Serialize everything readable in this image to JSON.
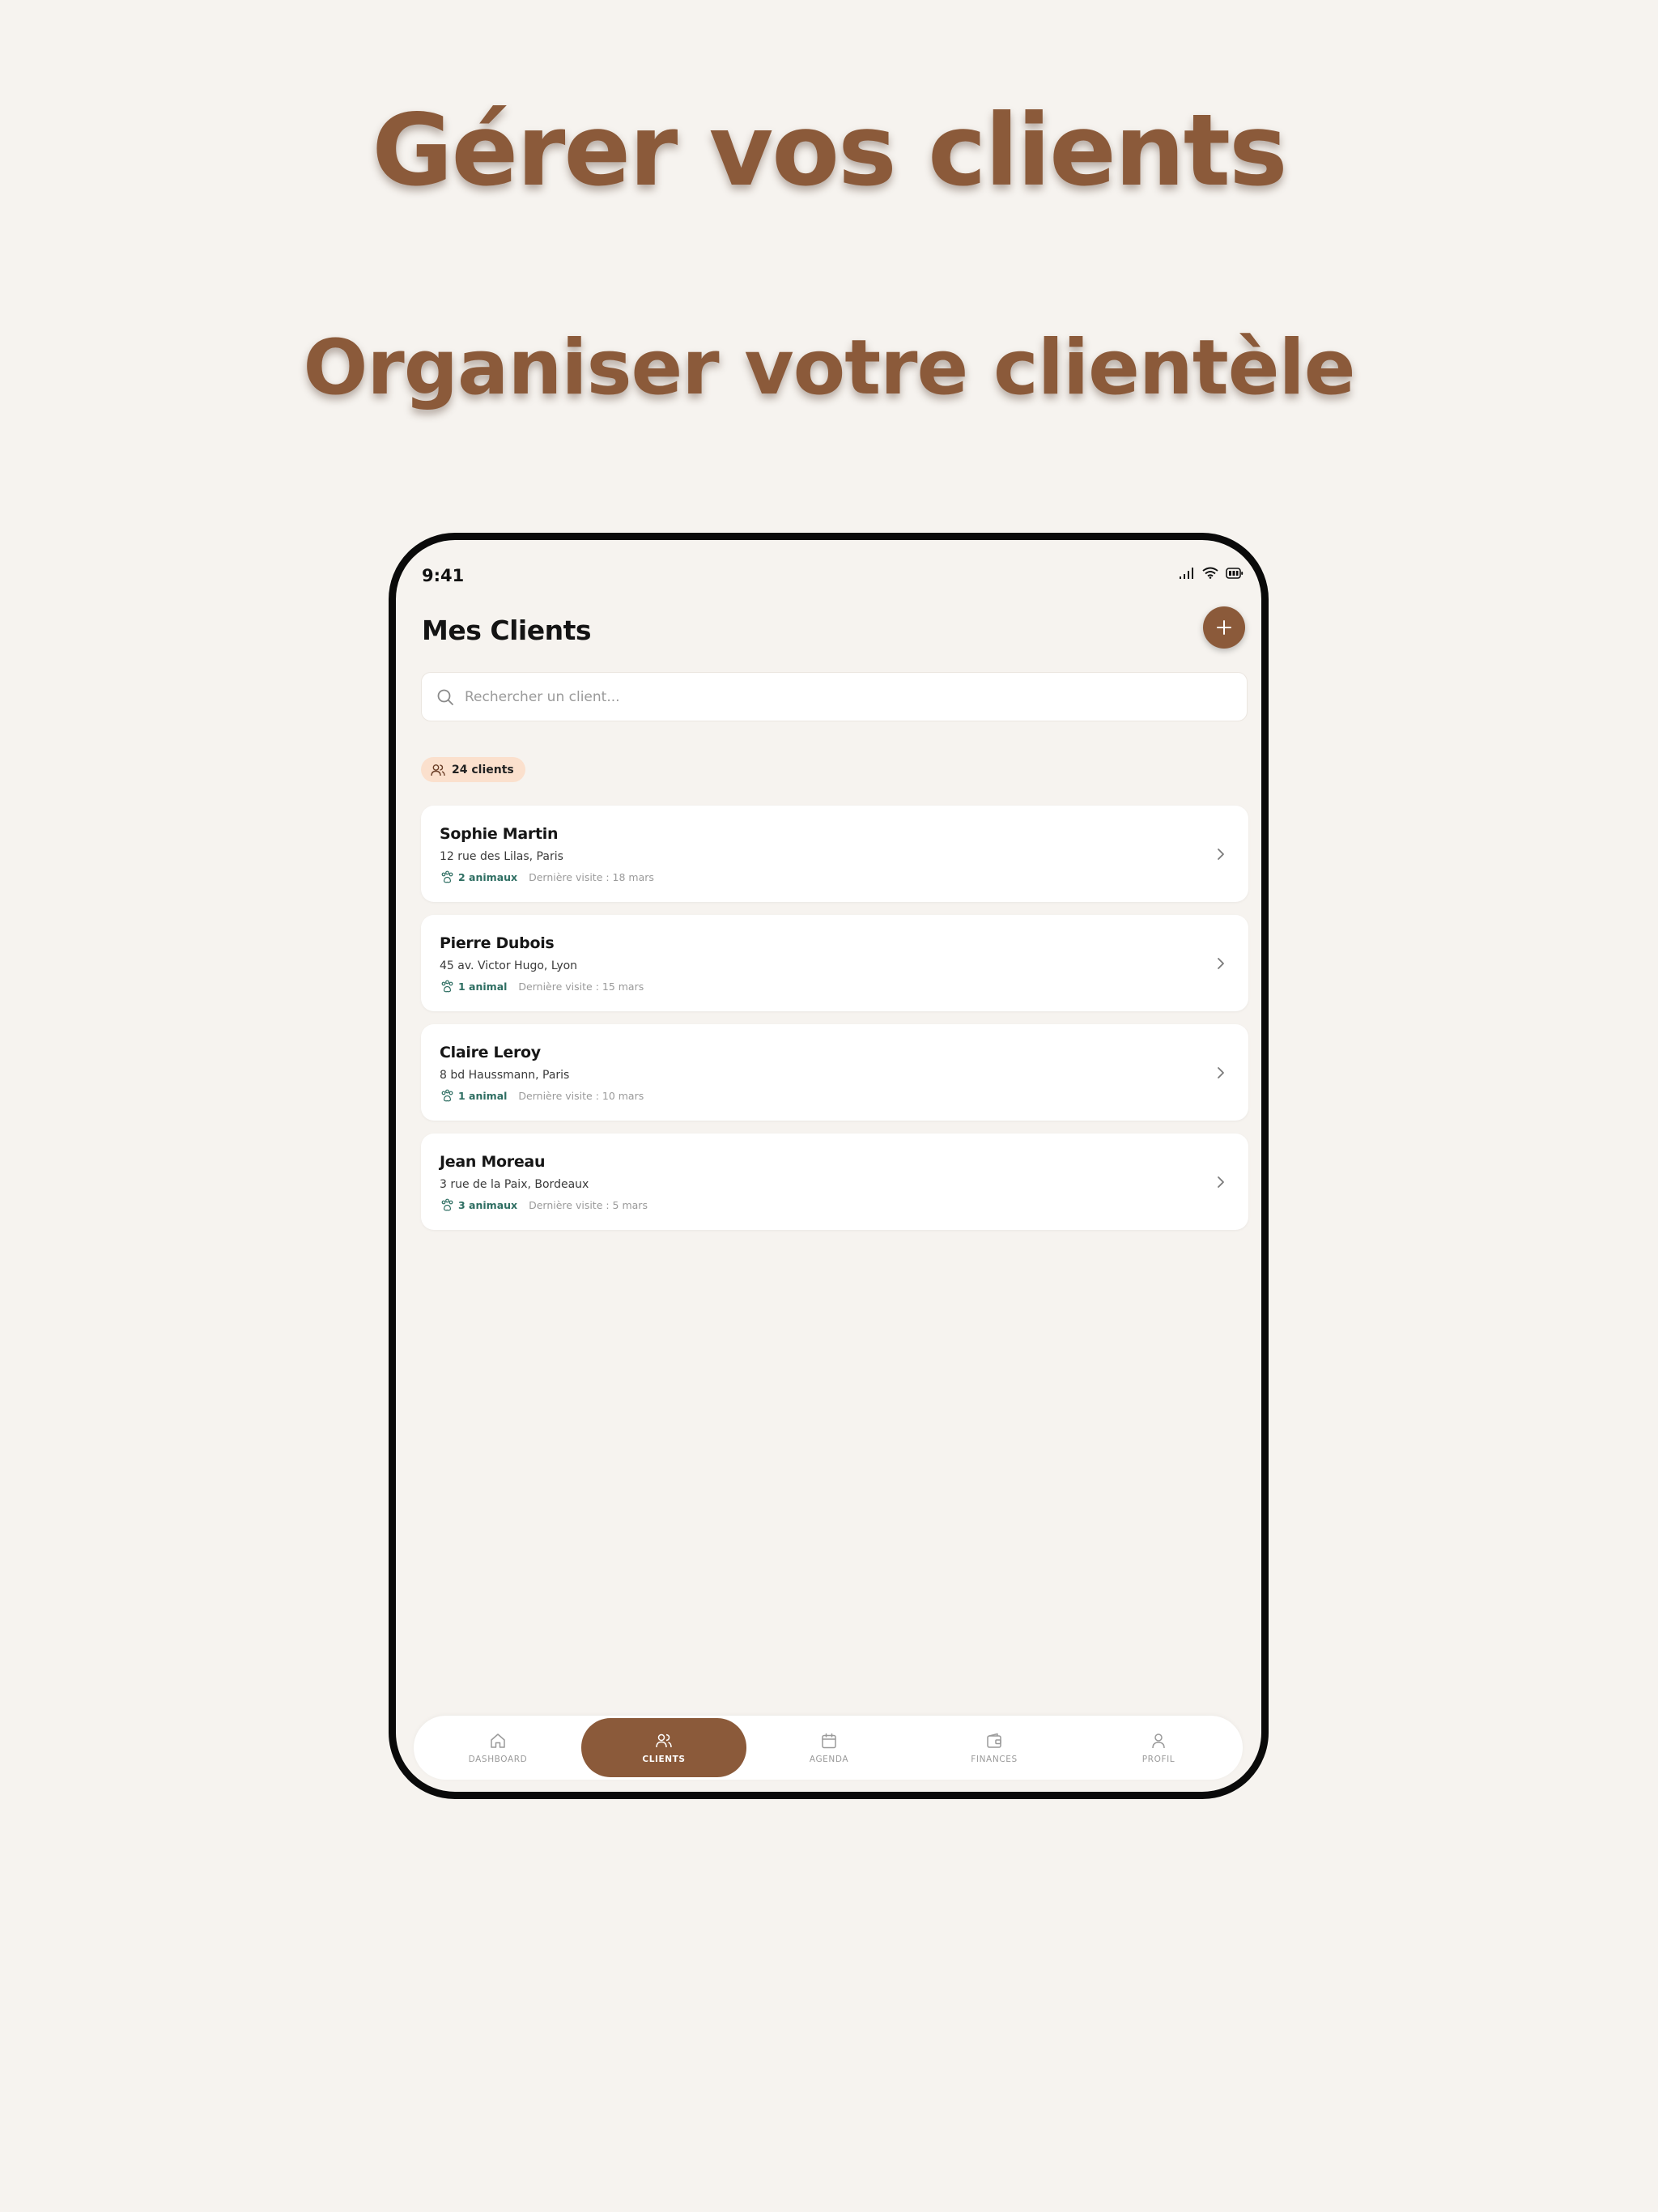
{
  "headline": {
    "title": "Gérer vos clients",
    "subtitle": "Organiser votre clientèle"
  },
  "status_bar": {
    "time": "9:41"
  },
  "header": {
    "title": "Mes Clients"
  },
  "search": {
    "placeholder": "Rechercher un client..."
  },
  "client_count": "24 clients",
  "clients": [
    {
      "name": "Sophie Martin",
      "address": "12 rue des Lilas, Paris",
      "animals": "2 animaux",
      "last_visit": "Dernière visite : 18 mars"
    },
    {
      "name": "Pierre Dubois",
      "address": "45 av. Victor Hugo, Lyon",
      "animals": "1 animal",
      "last_visit": "Dernière visite : 15 mars"
    },
    {
      "name": "Claire Leroy",
      "address": "8 bd Haussmann, Paris",
      "animals": "1 animal",
      "last_visit": "Dernière visite : 10 mars"
    },
    {
      "name": "Jean Moreau",
      "address": "3 rue de la Paix, Bordeaux",
      "animals": "3 animaux",
      "last_visit": "Dernière visite : 5 mars"
    }
  ],
  "nav": [
    {
      "label": "DASHBOARD",
      "icon": "home-icon"
    },
    {
      "label": "CLIENTS",
      "icon": "users-icon",
      "active": true
    },
    {
      "label": "AGENDA",
      "icon": "calendar-icon"
    },
    {
      "label": "FINANCES",
      "icon": "wallet-icon"
    },
    {
      "label": "PROFIL",
      "icon": "user-icon"
    }
  ],
  "colors": {
    "background": "#f6f3ef",
    "accent": "#8b5a3a",
    "badge": "#fbe0cd",
    "pet_count": "#2e6e62"
  }
}
